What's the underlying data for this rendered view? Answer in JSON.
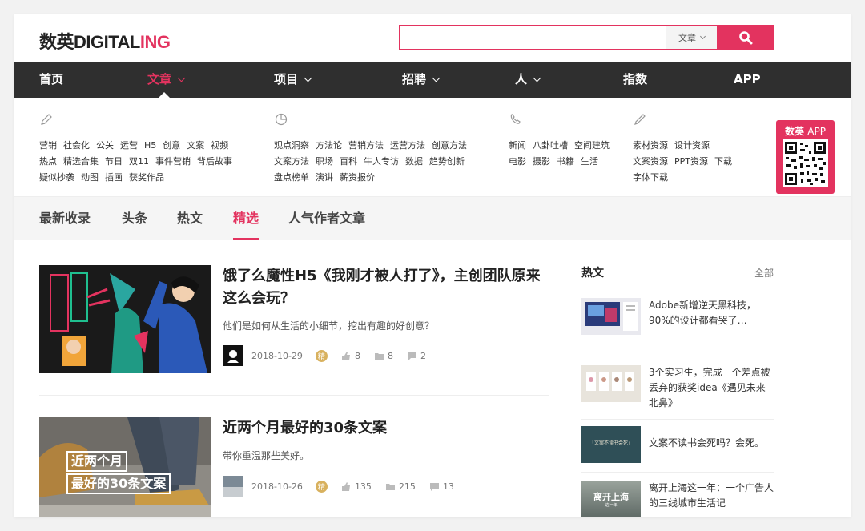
{
  "header": {
    "logo_main": "数英DIGITAL",
    "logo_highlight": "ING",
    "search_placeholder": "",
    "search_type": "文章",
    "search_icon": "search-icon",
    "brand_color": "#e3335f"
  },
  "nav": {
    "items": [
      {
        "label": "首页",
        "has_caret": false
      },
      {
        "label": "文章",
        "has_caret": true,
        "active": true
      },
      {
        "label": "项目",
        "has_caret": true
      },
      {
        "label": "招聘",
        "has_caret": true
      },
      {
        "label": "人",
        "has_caret": true
      },
      {
        "label": "指数",
        "has_caret": false
      },
      {
        "label": "APP",
        "has_caret": false
      }
    ]
  },
  "mega_menu": {
    "columns": [
      {
        "icon": "pen-icon",
        "links": [
          "营销",
          "社会化",
          "公关",
          "运营",
          "H5",
          "创意",
          "文案",
          "视频",
          "热点",
          "精选合集",
          "节日",
          "双11",
          "事件营销",
          "背后故事",
          "疑似抄袭",
          "动图",
          "插画",
          "获奖作品"
        ]
      },
      {
        "icon": "chart-icon",
        "links": [
          "观点洞察",
          "方法论",
          "营销方法",
          "运营方法",
          "创意方法",
          "文案方法",
          "职场",
          "百科",
          "牛人专访",
          "数据",
          "趋势创新",
          "盘点榜单",
          "演讲",
          "薪资报价"
        ]
      },
      {
        "icon": "phone-icon",
        "links": [
          "新闻",
          "八卦吐槽",
          "空间建筑",
          "电影",
          "摄影",
          "书籍",
          "生活"
        ]
      },
      {
        "icon": "pencil-icon",
        "links": [
          "素材资源",
          "设计资源",
          "文案资源",
          "PPT资源",
          "下载",
          "字体下载"
        ]
      }
    ],
    "app_badge": {
      "logo": "数英",
      "label": "APP"
    }
  },
  "tabs": [
    {
      "label": "最新收录"
    },
    {
      "label": "头条"
    },
    {
      "label": "热文"
    },
    {
      "label": "精选",
      "active": true
    },
    {
      "label": "人气作者文章"
    }
  ],
  "articles": [
    {
      "title": "饿了么魔性H5《我刚才被人打了》，主创团队原来这么会玩？",
      "desc": "他们是如何从生活的小细节，挖出有趣的好创意？",
      "date": "2018-10-29",
      "badge": "精",
      "likes": "8",
      "favorites": "8",
      "comments": "2"
    },
    {
      "title": "近两个月最好的30条文案",
      "desc": "带你重温那些美好。",
      "date": "2018-10-26",
      "badge": "精",
      "likes": "135",
      "favorites": "215",
      "comments": "13",
      "thumb_text_1": "近两个月",
      "thumb_text_2": "最好的30条文案"
    }
  ],
  "sidebar": {
    "title": "热文",
    "all_label": "全部",
    "items": [
      {
        "text": "Adobe新增逆天黑科技，90%的设计都看哭了…"
      },
      {
        "text": "3个实习生，完成一个差点被丢弃的获奖idea《遇见未来北鼻》"
      },
      {
        "text": "文案不读书会死吗？会死。",
        "thumb_text": "「文案不读书会死」"
      },
      {
        "text": "离开上海这一年：一个广告人的三线城市生活记",
        "thumb_text": "离开上海",
        "thumb_sub": "这一年"
      }
    ]
  }
}
